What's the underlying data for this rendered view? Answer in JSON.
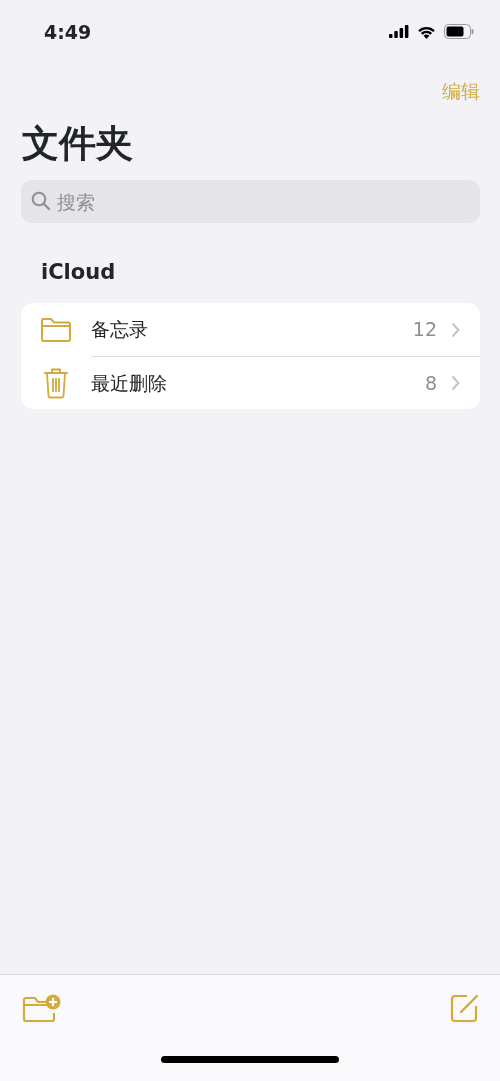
{
  "status_bar": {
    "time": "4:49"
  },
  "nav": {
    "edit_label": "编辑"
  },
  "title": "文件夹",
  "search": {
    "placeholder": "搜索"
  },
  "section": {
    "title": "iCloud"
  },
  "folders": [
    {
      "kind": "folder",
      "name": "备忘录",
      "count": "12"
    },
    {
      "kind": "trash",
      "name": "最近删除",
      "count": "8"
    }
  ]
}
